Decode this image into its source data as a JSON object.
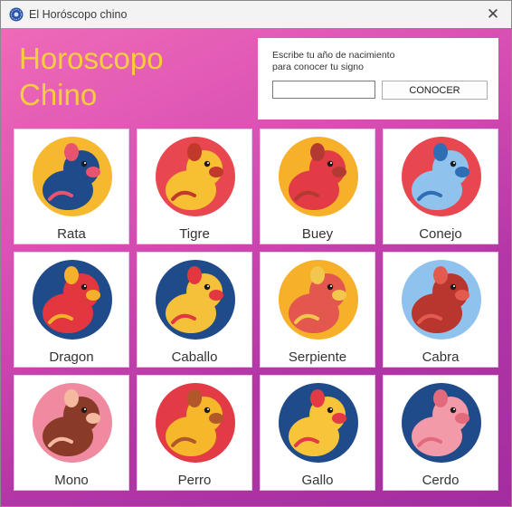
{
  "window": {
    "title": "El Horóscopo chino",
    "close_glyph": "✕"
  },
  "header": {
    "title_line1": "Horoscopo",
    "title_line2": "Chino",
    "title_color": "#f7cd3c"
  },
  "form": {
    "prompt_line1": "Escribe tu año de nacimiento",
    "prompt_line2": "para conocer tu signo",
    "year_value": "",
    "button_label": "CONOCER"
  },
  "signs": [
    {
      "name": "Rata",
      "icon": "rat-icon",
      "bg": "#f5b82e",
      "main": "#1f4b8a",
      "accent": "#e8546f"
    },
    {
      "name": "Tigre",
      "icon": "tiger-icon",
      "bg": "#e8474f",
      "main": "#f7c033",
      "accent": "#c0392b"
    },
    {
      "name": "Buey",
      "icon": "ox-icon",
      "bg": "#f6b02a",
      "main": "#e23b46",
      "accent": "#b23a33"
    },
    {
      "name": "Conejo",
      "icon": "rabbit-icon",
      "bg": "#e8474f",
      "main": "#8fc3ee",
      "accent": "#2f6db5"
    },
    {
      "name": "Dragon",
      "icon": "dragon-icon",
      "bg": "#1f4b8a",
      "main": "#e2373f",
      "accent": "#f6b02a"
    },
    {
      "name": "Caballo",
      "icon": "horse-icon",
      "bg": "#1f4b8a",
      "main": "#f6c13a",
      "accent": "#e2373f"
    },
    {
      "name": "Serpiente",
      "icon": "snake-icon",
      "bg": "#f6b02a",
      "main": "#e3574f",
      "accent": "#f3c64e"
    },
    {
      "name": "Cabra",
      "icon": "goat-icon",
      "bg": "#8fc3ee",
      "main": "#b8362e",
      "accent": "#e45a4f"
    },
    {
      "name": "Mono",
      "icon": "monkey-icon",
      "bg": "#f08aa0",
      "main": "#8a3b28",
      "accent": "#f4b99e"
    },
    {
      "name": "Perro",
      "icon": "dog-icon",
      "bg": "#e23b46",
      "main": "#f6b82a",
      "accent": "#b2572a"
    },
    {
      "name": "Gallo",
      "icon": "rooster-icon",
      "bg": "#1f4b8a",
      "main": "#f7c43a",
      "accent": "#e23b46"
    },
    {
      "name": "Cerdo",
      "icon": "pig-icon",
      "bg": "#1f4b8a",
      "main": "#f39aa8",
      "accent": "#e26a7c"
    }
  ]
}
